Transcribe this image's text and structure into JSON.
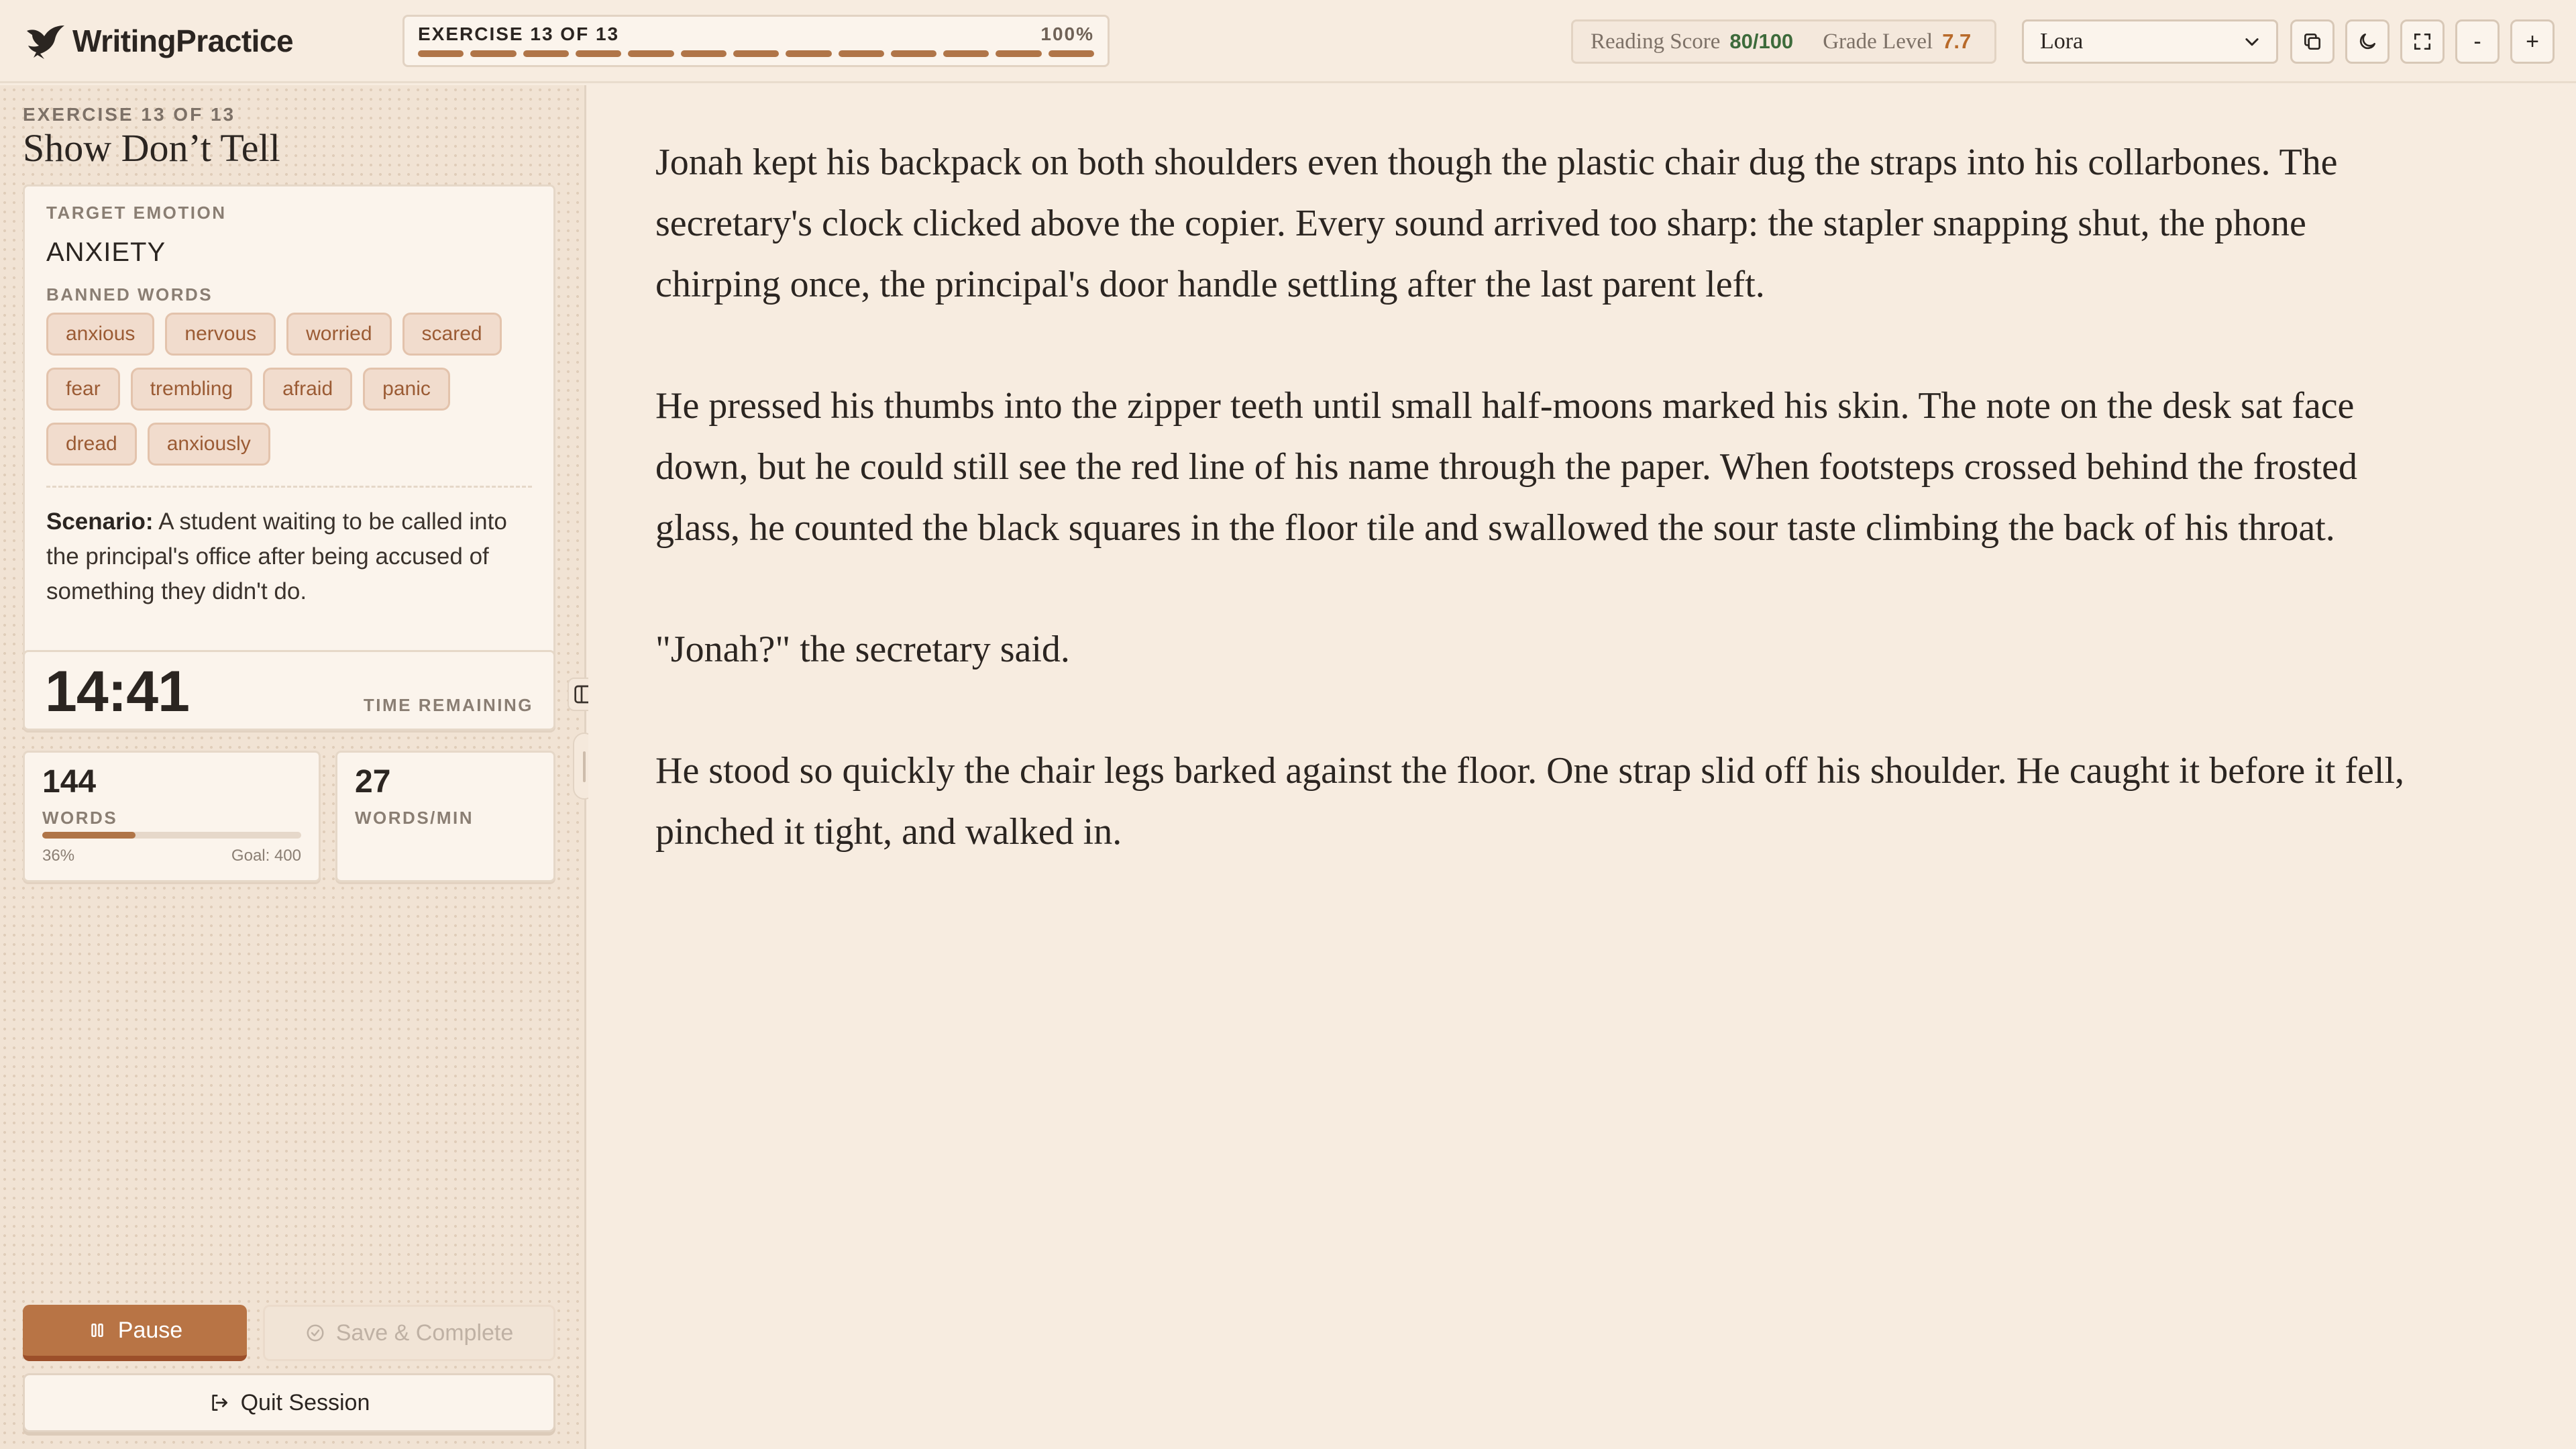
{
  "app": {
    "name": "WritingPractice"
  },
  "header": {
    "exercise_progress_label": "EXERCISE 13 OF 13",
    "progress_percent_label": "100%",
    "progress": {
      "completed": 13,
      "total": 13
    },
    "reading_score_label": "Reading Score",
    "reading_score_value": "80/100",
    "grade_level_label": "Grade Level",
    "grade_level_value": "7.7",
    "font_select": {
      "selected": "Lora"
    },
    "tools": [
      {
        "name": "copy-button",
        "icon": "copy-icon"
      },
      {
        "name": "dark-mode-button",
        "icon": "moon-icon"
      },
      {
        "name": "fullscreen-button",
        "icon": "fullscreen-icon"
      },
      {
        "name": "font-decrease-button",
        "label": "-"
      },
      {
        "name": "font-increase-button",
        "label": "+"
      }
    ]
  },
  "sidebar": {
    "kicker": "EXERCISE 13 OF 13",
    "title": "Show Don’t Tell",
    "target_emotion_label": "TARGET EMOTION",
    "target_emotion": "ANXIETY",
    "banned_words_label": "BANNED WORDS",
    "banned_words": [
      [
        "anxious",
        "nervous",
        "worried",
        "scared"
      ],
      [
        "fear",
        "trembling",
        "afraid",
        "panic"
      ],
      [
        "dread",
        "anxiously"
      ]
    ],
    "scenario_label": "Scenario:",
    "scenario_text": "A student waiting to be called into the principal's office after being accused of something they didn't do.",
    "timer": {
      "value": "14:41",
      "label": "TIME REMAINING"
    },
    "words": {
      "value": "144",
      "label": "WORDS",
      "progress_pct_label": "36%",
      "progress_fraction": 0.36,
      "goal_label": "Goal: 400"
    },
    "wpm": {
      "value": "27",
      "label": "WORDS/MIN"
    },
    "buttons": {
      "pause": "Pause",
      "save": "Save & Complete",
      "quit": "Quit Session"
    }
  },
  "editor": {
    "paragraphs": [
      "Jonah kept his backpack on both shoulders even though the plastic chair dug the straps into his collarbones. The secretary's clock clicked above the copier. Every sound arrived too sharp: the stapler snapping shut, the phone chirping once, the principal's door handle settling after the last parent left.",
      "He pressed his thumbs into the zipper teeth until small half-moons marked his skin. The note on the desk sat face down, but he could still see the red line of his name through the paper. When footsteps crossed behind the frosted glass, he counted the black squares in the floor tile and swallowed the sour taste climbing the back of his throat.",
      "\"Jonah?\" the secretary said.",
      "He stood so quickly the chair legs barked against the floor. One strap slid off his shoulder. He caught it before it fell, pinched it tight, and walked in."
    ]
  },
  "colors": {
    "background": "#f7ece0",
    "accent": "#b87445",
    "chip_text": "#9b5b34",
    "score_green": "#3d6b3b",
    "grade_orange": "#b86a2a"
  }
}
